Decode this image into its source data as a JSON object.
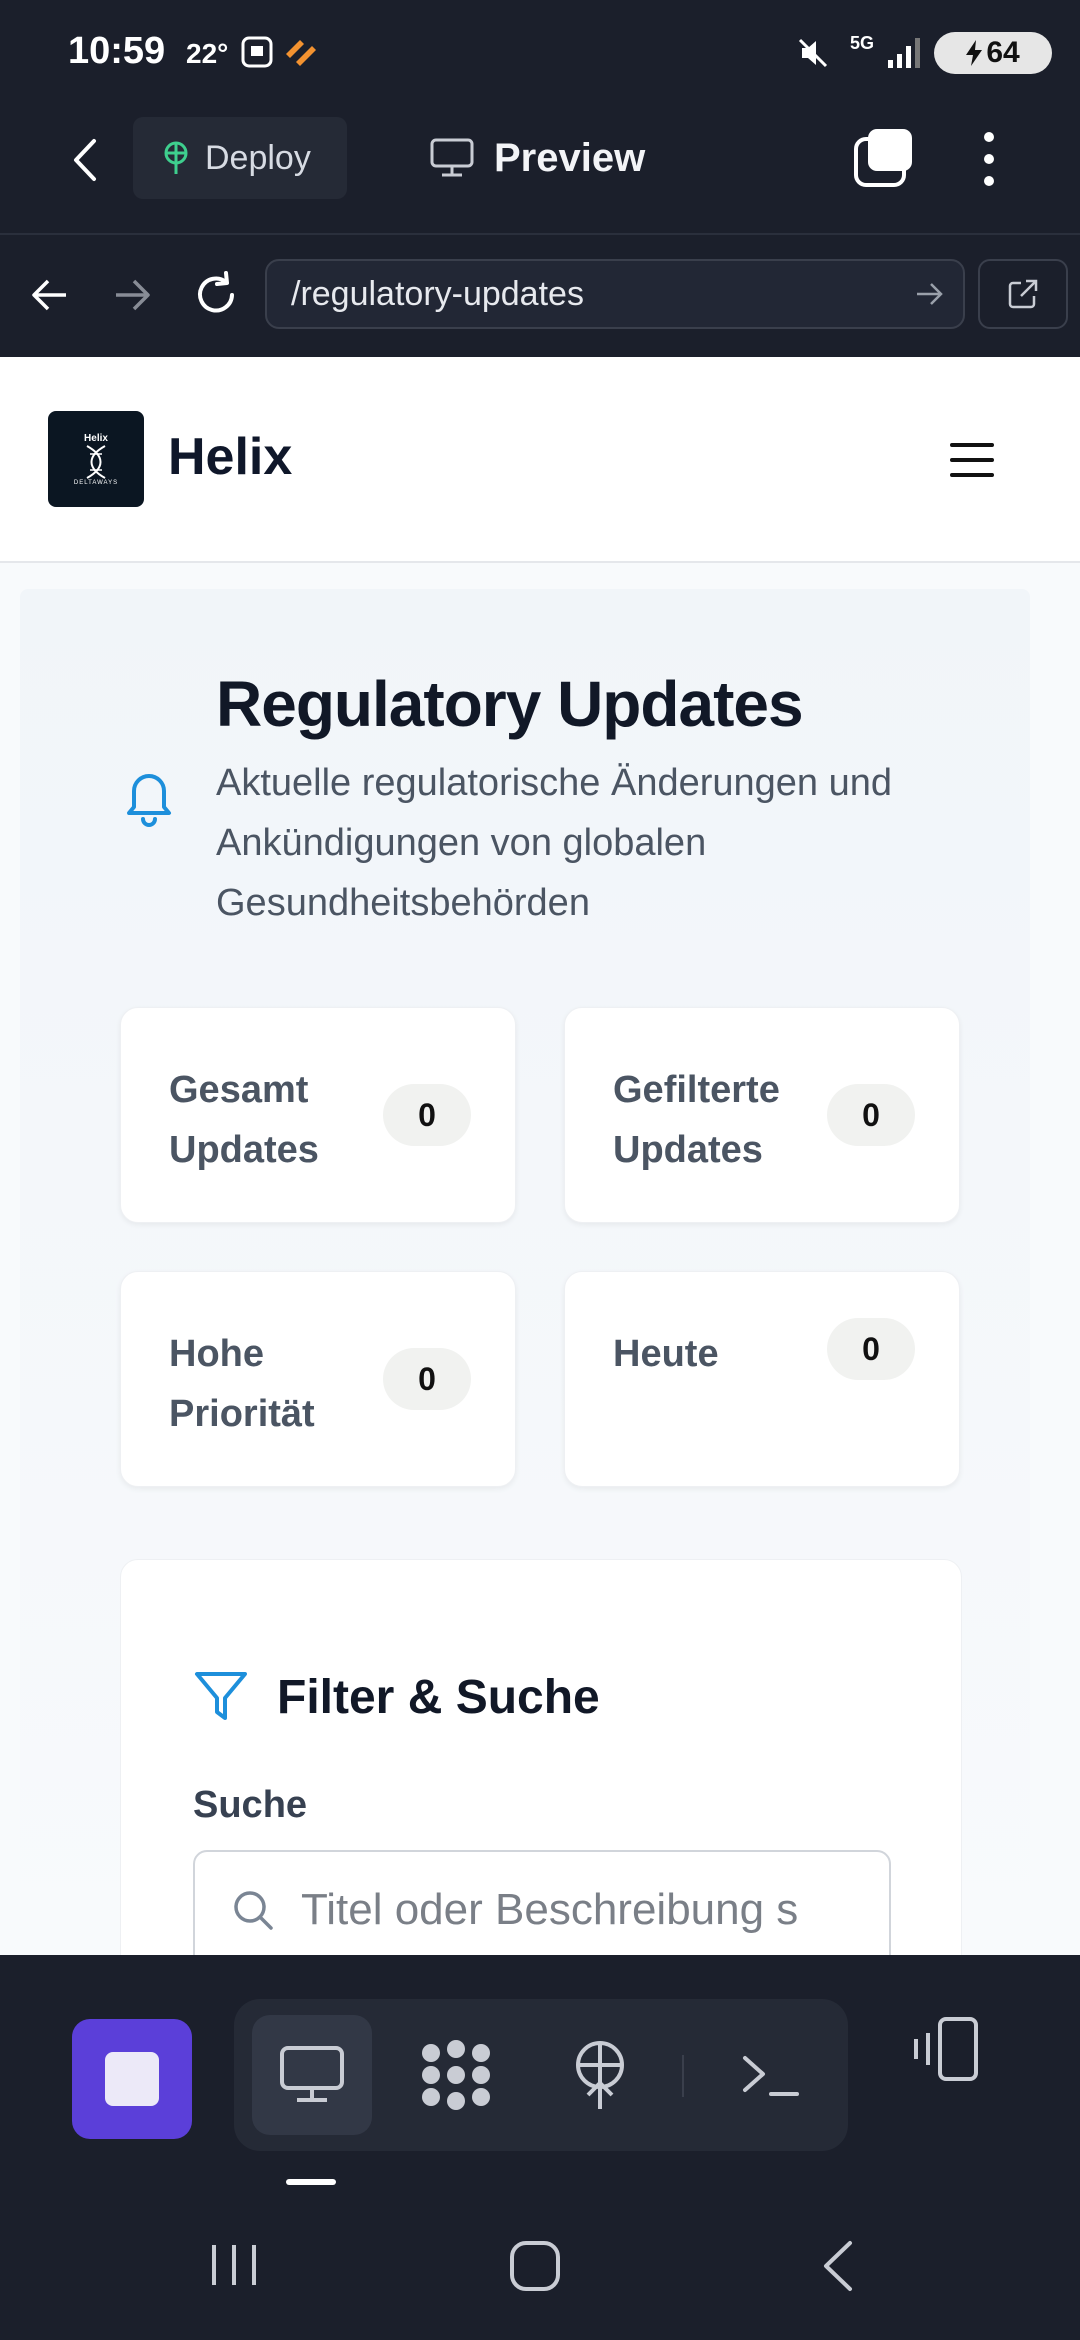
{
  "status_bar": {
    "time": "10:59",
    "temperature": "22°",
    "network": "5G",
    "battery": "64"
  },
  "top_bar": {
    "deploy_label": "Deploy",
    "preview_label": "Preview"
  },
  "browser": {
    "url": "/regulatory-updates"
  },
  "site": {
    "brand": "Helix",
    "logo_text": "Helix",
    "logo_subtext": "DELTAWAYS"
  },
  "page": {
    "title": "Regulatory Updates",
    "subtitle": "Aktuelle regulatorische Änderungen und Ankündigungen von globalen Gesundheitsbehörden"
  },
  "stats": [
    {
      "label": "Gesamt Updates",
      "value": "0"
    },
    {
      "label": "Gefilterte Updates",
      "value": "0"
    },
    {
      "label": "Hohe Priorität",
      "value": "0"
    },
    {
      "label": "Heute",
      "value": "0"
    }
  ],
  "filter": {
    "title": "Filter & Suche",
    "search_label": "Suche",
    "search_placeholder": "Titel oder Beschreibung s"
  },
  "colors": {
    "accent_blue": "#1d8fdb",
    "stop_button": "#5b3fd9",
    "dark_bg": "#1b1f2b"
  }
}
